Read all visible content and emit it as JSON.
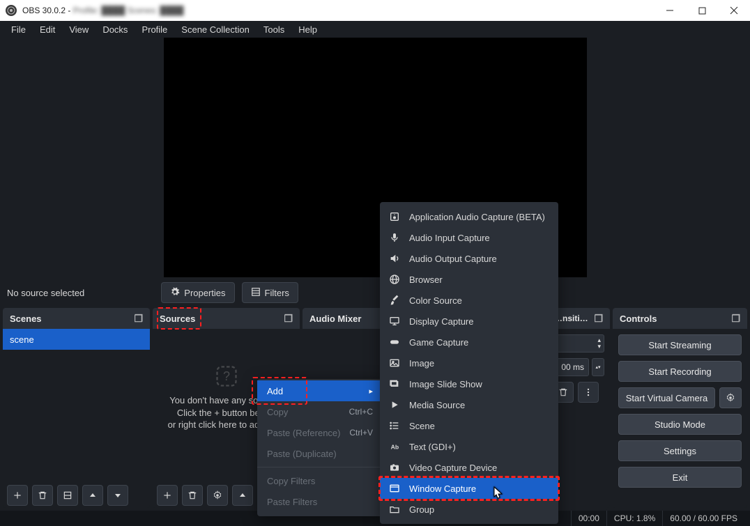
{
  "titlebar": {
    "app": "OBS 30.0.2 -",
    "blurred": "Profile: ████   Scenes: ████"
  },
  "menubar": [
    "File",
    "Edit",
    "View",
    "Docks",
    "Profile",
    "Scene Collection",
    "Tools",
    "Help"
  ],
  "toolbar": {
    "selected": "No source selected",
    "properties": "Properties",
    "filters": "Filters"
  },
  "docks": {
    "scenes": {
      "title": "Scenes",
      "items": [
        "scene"
      ]
    },
    "sources": {
      "title": "Sources",
      "empty": "You don't have any sources.\nClick the + button below,\nor right click here to add one."
    },
    "audio": {
      "title": "Audio Mixer"
    },
    "transitions": {
      "title": "…nsiti…",
      "duration": "00 ms"
    },
    "controls": {
      "title": "Controls",
      "buttons": {
        "stream": "Start Streaming",
        "record": "Start Recording",
        "vcam": "Start Virtual Camera",
        "studio": "Studio Mode",
        "settings": "Settings",
        "exit": "Exit"
      }
    }
  },
  "context1": {
    "add": "Add",
    "copy": {
      "label": "Copy",
      "shortcut": "Ctrl+C"
    },
    "pasteRef": {
      "label": "Paste (Reference)",
      "shortcut": "Ctrl+V"
    },
    "pasteDup": "Paste (Duplicate)",
    "copyFilters": "Copy Filters",
    "pasteFilters": "Paste Filters"
  },
  "context2": {
    "items": [
      {
        "icon": "speaker-box",
        "label": "Application Audio Capture (BETA)"
      },
      {
        "icon": "mic",
        "label": "Audio Input Capture"
      },
      {
        "icon": "speaker",
        "label": "Audio Output Capture"
      },
      {
        "icon": "globe",
        "label": "Browser"
      },
      {
        "icon": "brush",
        "label": "Color Source"
      },
      {
        "icon": "monitor",
        "label": "Display Capture"
      },
      {
        "icon": "gamepad",
        "label": "Game Capture"
      },
      {
        "icon": "image",
        "label": "Image"
      },
      {
        "icon": "slides",
        "label": "Image Slide Show"
      },
      {
        "icon": "play",
        "label": "Media Source"
      },
      {
        "icon": "list",
        "label": "Scene"
      },
      {
        "icon": "text",
        "label": "Text (GDI+)"
      },
      {
        "icon": "camera",
        "label": "Video Capture Device"
      },
      {
        "icon": "window",
        "label": "Window Capture",
        "highlight": true
      },
      {
        "icon": "folder",
        "label": "Group"
      }
    ]
  },
  "statusbar": {
    "time": "00:00",
    "cpu": "CPU: 1.8%",
    "fps": "60.00 / 60.00 FPS"
  }
}
